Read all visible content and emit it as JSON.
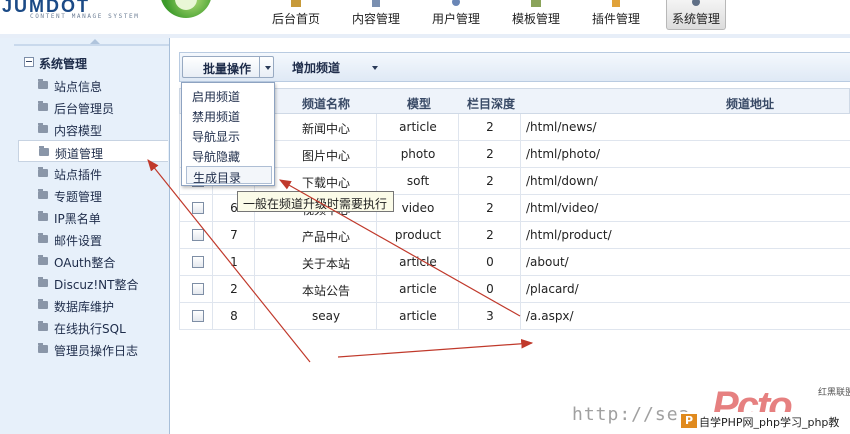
{
  "logo": {
    "text": "JUMDOT",
    "subtitle": "CONTENT MANAGE SYSTEM"
  },
  "nav": [
    {
      "label": "后台首页",
      "icon": "home-icon"
    },
    {
      "label": "内容管理",
      "icon": "pencil-icon"
    },
    {
      "label": "用户管理",
      "icon": "users-icon"
    },
    {
      "label": "模板管理",
      "icon": "template-icon"
    },
    {
      "label": "插件管理",
      "icon": "plugin-icon"
    },
    {
      "label": "系统管理",
      "icon": "settings-icon"
    }
  ],
  "sidebar": {
    "group": "系统管理",
    "items": [
      {
        "label": "站点信息"
      },
      {
        "label": "后台管理员"
      },
      {
        "label": "内容模型"
      },
      {
        "label": "频道管理"
      },
      {
        "label": "站点插件"
      },
      {
        "label": "专题管理"
      },
      {
        "label": "IP黑名单"
      },
      {
        "label": "邮件设置"
      },
      {
        "label": "OAuth整合"
      },
      {
        "label": "Discuz!NT整合"
      },
      {
        "label": "数据库维护"
      },
      {
        "label": "在线执行SQL"
      },
      {
        "label": "管理员操作日志"
      }
    ]
  },
  "toolbar": {
    "batch_label": "批量操作",
    "add_label": "增加频道"
  },
  "menu": [
    "启用频道",
    "禁用频道",
    "导航显示",
    "导航隐藏",
    "生成目录"
  ],
  "tooltip": "一般在频道升级时需要执行",
  "table": {
    "headers": [
      "频道名称",
      "模型",
      "栏目深度",
      "频道地址"
    ],
    "rows": [
      {
        "id": "",
        "name": "新闻中心",
        "model": "article",
        "depth": "2",
        "url": "/html/news/"
      },
      {
        "id": "",
        "name": "图片中心",
        "model": "photo",
        "depth": "2",
        "url": "/html/photo/"
      },
      {
        "id": "",
        "name": "下载中心",
        "model": "soft",
        "depth": "2",
        "url": "/html/down/"
      },
      {
        "id": "6",
        "name": "视频中心",
        "model": "video",
        "depth": "2",
        "url": "/html/video/"
      },
      {
        "id": "7",
        "name": "产品中心",
        "model": "product",
        "depth": "2",
        "url": "/html/product/"
      },
      {
        "id": "1",
        "name": "关于本站",
        "model": "article",
        "depth": "0",
        "url": "/about/"
      },
      {
        "id": "2",
        "name": "本站公告",
        "model": "article",
        "depth": "0",
        "url": "/placard/"
      },
      {
        "id": "8",
        "name": "seay",
        "model": "article",
        "depth": "3",
        "url": "/a.aspx/"
      }
    ]
  },
  "watermark": {
    "url": "http://sea",
    "logo": "Pcto",
    "brand": "红黑联盟",
    "bar_icon": "P",
    "bar_text": "自学PHP网_php学习_php教"
  },
  "colors": {
    "sidebar_bg": "#e7f0fa",
    "arrow": "#c0392b",
    "accent": "#1e2c4a"
  }
}
